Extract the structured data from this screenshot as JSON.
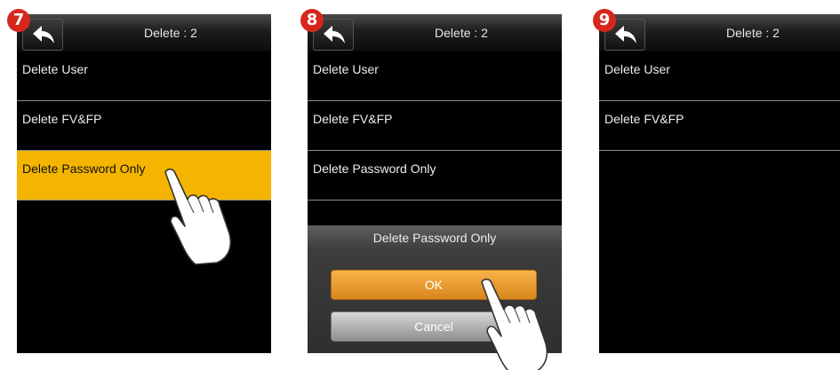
{
  "steps": [
    {
      "badge": "7",
      "title": "Delete : 2",
      "items": [
        "Delete User",
        "Delete FV&FP",
        "Delete Password Only"
      ],
      "selected_item": "Delete Password Only"
    },
    {
      "badge": "8",
      "title": "Delete : 2",
      "items": [
        "Delete User",
        "Delete FV&FP",
        "Delete Password Only"
      ],
      "dialog": {
        "title": "Delete Password Only",
        "ok_label": "OK",
        "cancel_label": "Cancel"
      }
    },
    {
      "badge": "9",
      "title": "Delete : 2",
      "items": [
        "Delete User",
        "Delete FV&FP"
      ]
    }
  ],
  "colors": {
    "badge": "#d7261c",
    "selected": "#f4b400",
    "ok_button": "#e59a2e",
    "cancel_button": "#b5b5b5",
    "screen": "#000000"
  },
  "icons": [
    "back-arrow-icon",
    "pointing-hand-icon"
  ]
}
